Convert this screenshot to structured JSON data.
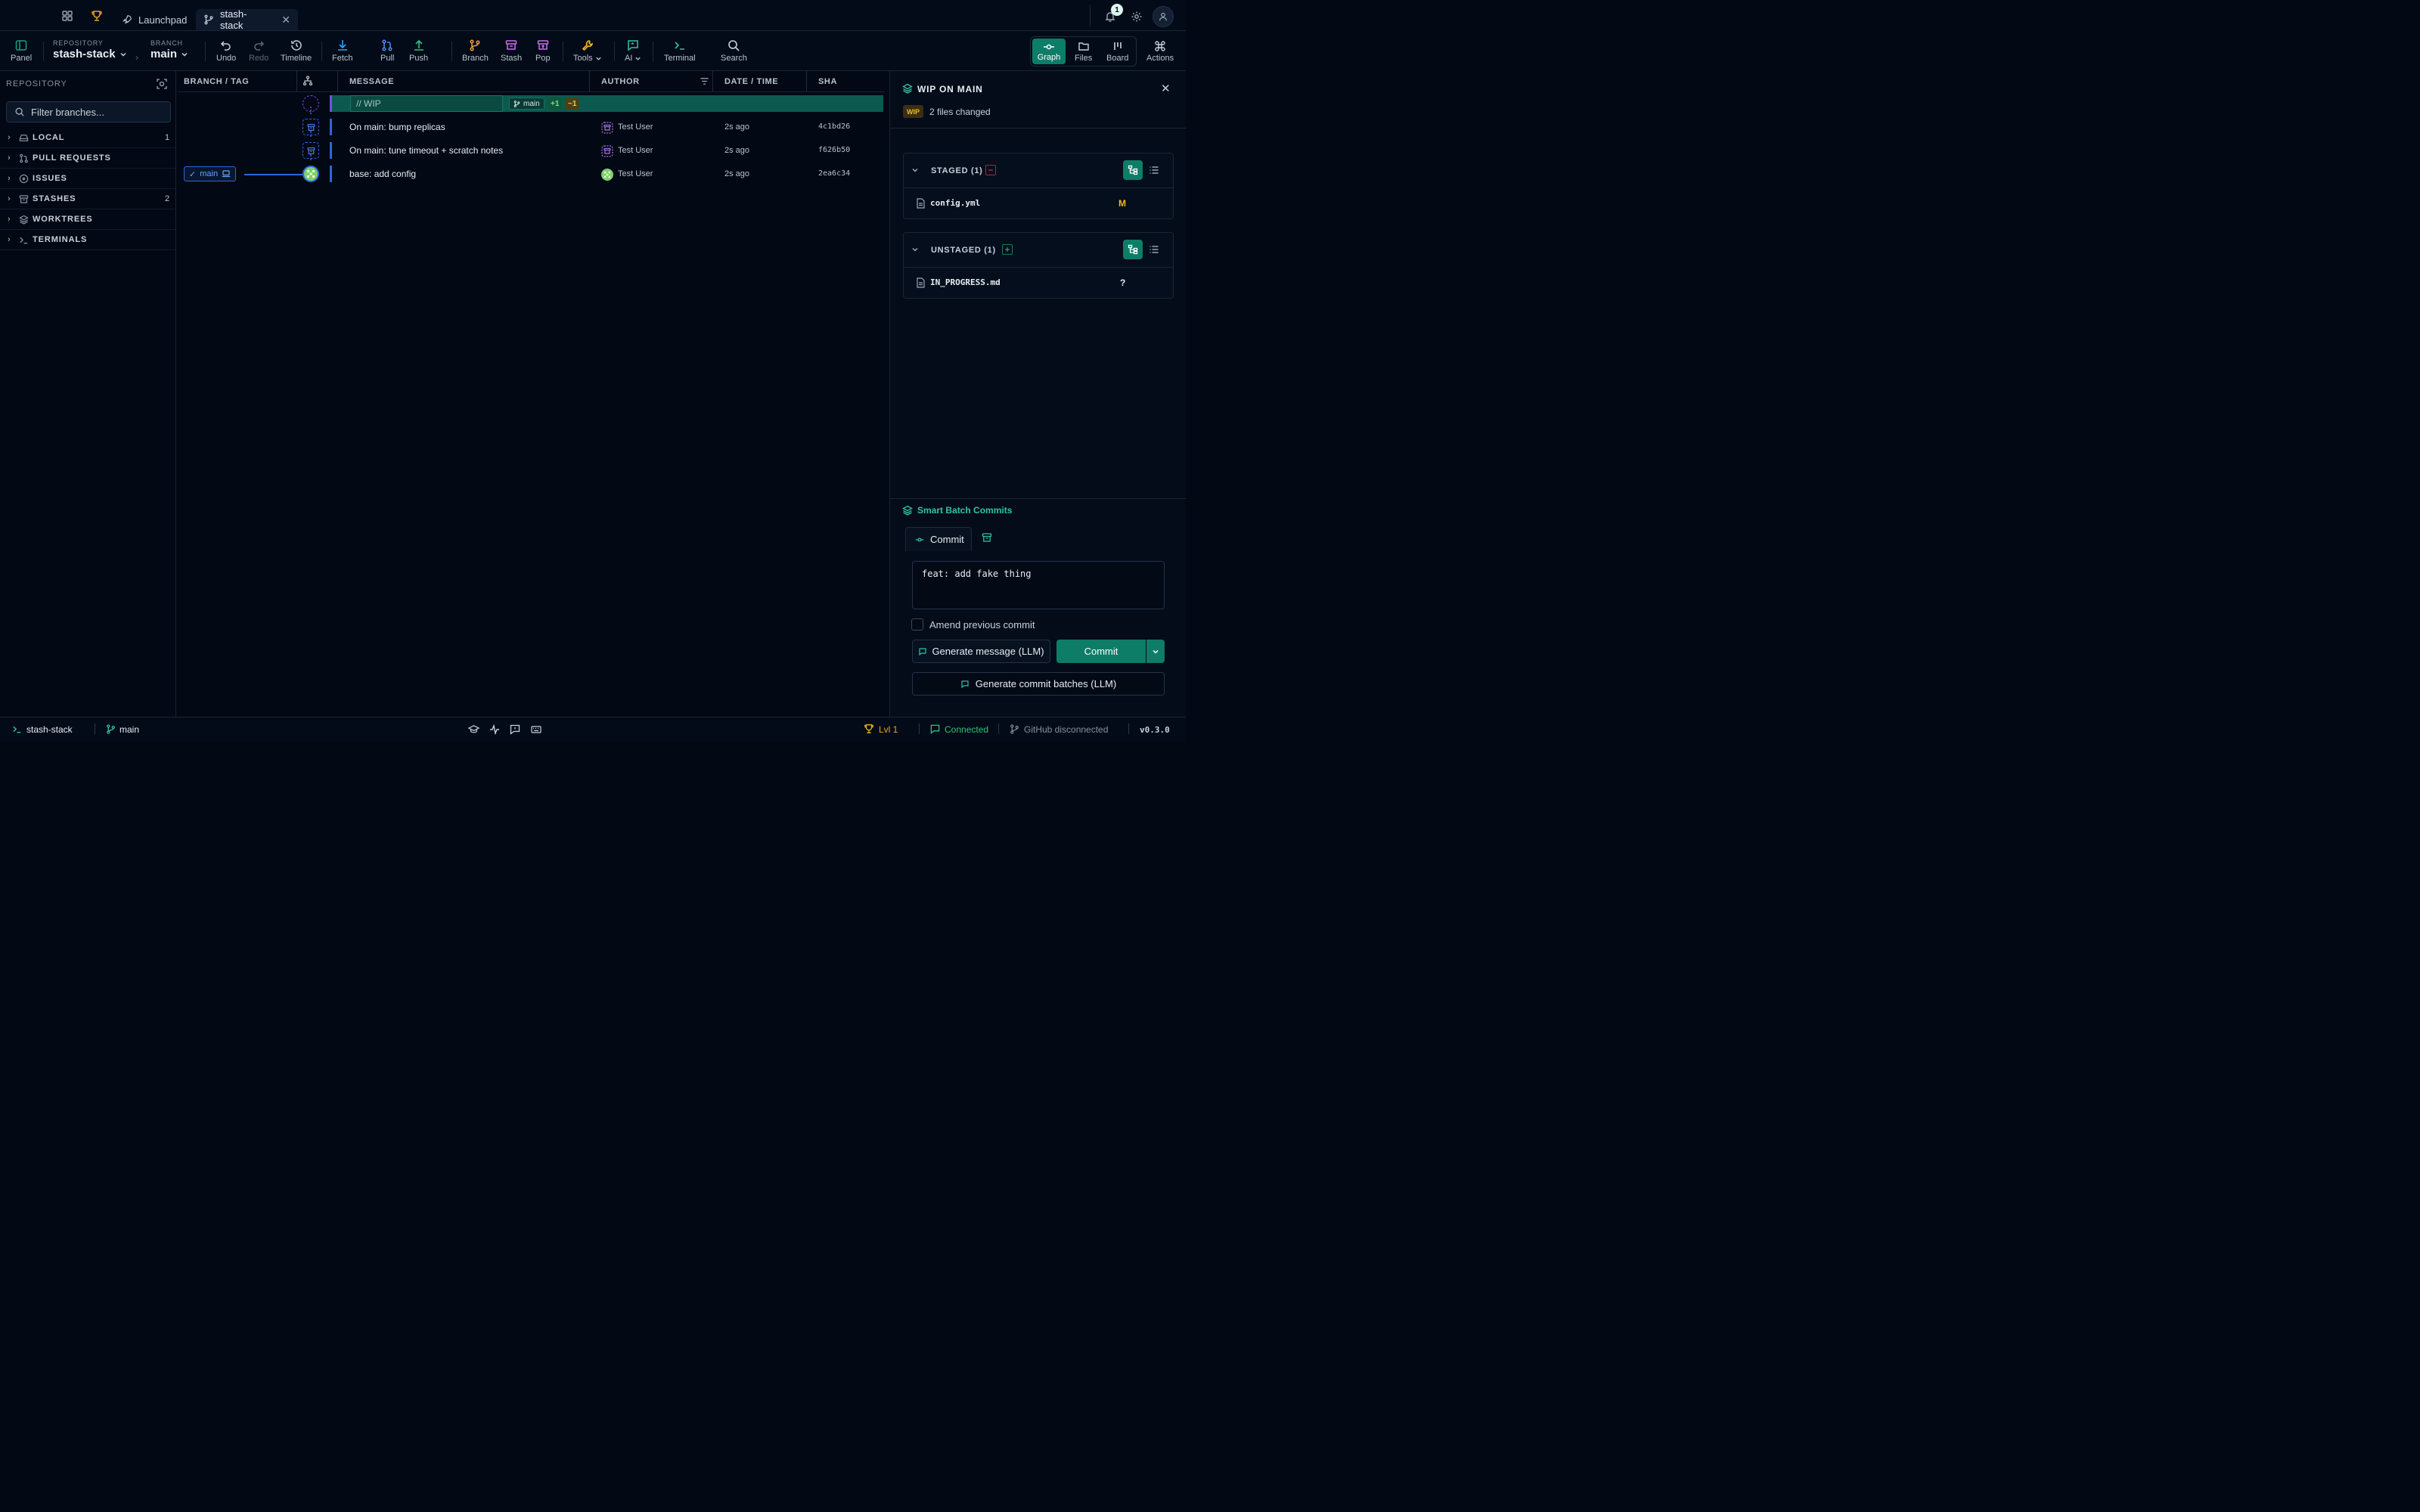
{
  "tabbar": {
    "tabs": [
      {
        "label": "Launchpad"
      },
      {
        "label": "stash-stack"
      }
    ],
    "notification_count": "1"
  },
  "toolbar": {
    "panel_label": "Panel",
    "repository_caption": "REPOSITORY",
    "repository_name": "stash-stack",
    "branch_caption": "BRANCH",
    "branch_name": "main",
    "undo": "Undo",
    "redo": "Redo",
    "timeline": "Timeline",
    "fetch": "Fetch",
    "pull": "Pull",
    "push": "Push",
    "branch": "Branch",
    "stash": "Stash",
    "pop": "Pop",
    "tools": "Tools",
    "ai": "AI",
    "terminal": "Terminal",
    "search": "Search",
    "views": [
      "Graph",
      "Files",
      "Board"
    ],
    "actions": "Actions"
  },
  "sidebar": {
    "title": "REPOSITORY",
    "filter_placeholder": "Filter branches...",
    "items": [
      {
        "label": "LOCAL",
        "count": "1"
      },
      {
        "label": "PULL REQUESTS",
        "count": ""
      },
      {
        "label": "ISSUES",
        "count": ""
      },
      {
        "label": "STASHES",
        "count": "2"
      },
      {
        "label": "WORKTREES",
        "count": ""
      },
      {
        "label": "TERMINALS",
        "count": ""
      }
    ]
  },
  "graph": {
    "headers": {
      "branch_tag": "BRANCH / TAG",
      "message": "MESSAGE",
      "author": "AUTHOR",
      "date_time": "DATE / TIME",
      "sha": "SHA"
    },
    "wip": {
      "label": "// WIP",
      "branch": "main",
      "added": "+1",
      "modified": "~1"
    },
    "commits": [
      {
        "message": "On main: bump replicas",
        "author": "Test User",
        "date": "2s ago",
        "sha": "4c1bd26"
      },
      {
        "message": "On main: tune timeout + scratch notes",
        "author": "Test User",
        "date": "2s ago",
        "sha": "f626b50"
      },
      {
        "message": "base: add config",
        "author": "Test User",
        "date": "2s ago",
        "sha": "2ea6c34"
      }
    ],
    "branch_badge": "main"
  },
  "rpanel": {
    "title": "WIP ON MAIN",
    "wip_badge": "WIP",
    "files_changed": "2 files changed",
    "staged": {
      "label": "STAGED (1)",
      "files": [
        {
          "name": "config.yml",
          "status": "M"
        }
      ]
    },
    "unstaged": {
      "label": "UNSTAGED (1)",
      "files": [
        {
          "name": "IN_PROGRESS.md",
          "status": "?"
        }
      ]
    },
    "smart_batch": "Smart Batch Commits",
    "commit_tab": "Commit",
    "commit_message": "feat: add fake thing",
    "amend_label": "Amend previous commit",
    "generate_message": "Generate message (LLM)",
    "commit_button": "Commit",
    "generate_batches": "Generate commit batches (LLM)"
  },
  "status": {
    "terminal": "stash-stack",
    "branch": "main",
    "level": "Lvl 1",
    "connected": "Connected",
    "github": "GitHub disconnected",
    "version": "v0.3.0"
  },
  "colors": {
    "accent": "#12a386",
    "accent_dark": "#0d7d68",
    "wip_purple": "#7c4ddb",
    "stash_blue": "#2f66d8",
    "modified_yellow": "#f2b81f",
    "warning": "#e0a61a"
  }
}
